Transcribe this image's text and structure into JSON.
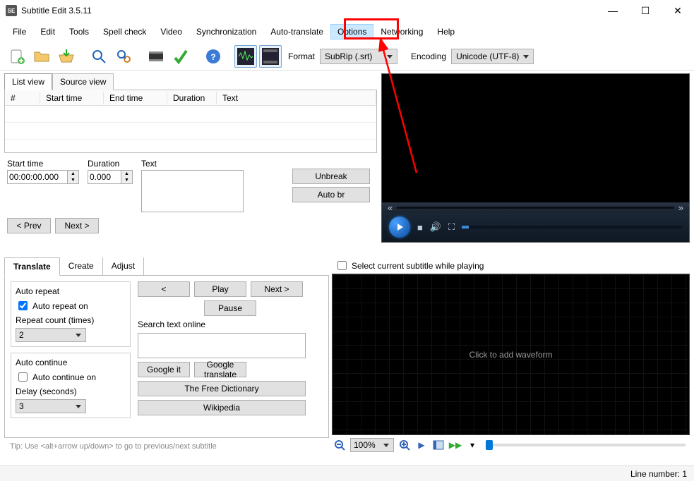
{
  "title": "Subtitle Edit 3.5.11",
  "menu": {
    "file": "File",
    "edit": "Edit",
    "tools": "Tools",
    "spell": "Spell check",
    "video": "Video",
    "sync": "Synchronization",
    "auto": "Auto-translate",
    "options": "Options",
    "net": "Networking",
    "help": "Help"
  },
  "format": {
    "label": "Format",
    "value": "SubRip (.srt)"
  },
  "encoding": {
    "label": "Encoding",
    "value": "Unicode (UTF-8)"
  },
  "tabs": {
    "list": "List view",
    "source": "Source view"
  },
  "grid": {
    "num": "#",
    "start": "Start time",
    "end": "End time",
    "dur": "Duration",
    "text": "Text"
  },
  "edit": {
    "start_label": "Start time",
    "start_val": "00:00:00.000",
    "dur_label": "Duration",
    "dur_val": "0.000",
    "text_label": "Text",
    "unbreak": "Unbreak",
    "autobr": "Auto br",
    "prev": "< Prev",
    "next": "Next >"
  },
  "bottabs": {
    "translate": "Translate",
    "create": "Create",
    "adjust": "Adjust"
  },
  "auto_repeat": {
    "title": "Auto repeat",
    "on": "Auto repeat on",
    "count_label": "Repeat count (times)",
    "count_val": "2"
  },
  "auto_cont": {
    "title": "Auto continue",
    "on": "Auto continue on",
    "delay_label": "Delay (seconds)",
    "delay_val": "3"
  },
  "pb": {
    "prev": "<",
    "play": "Play",
    "next": "Next >",
    "pause": "Pause"
  },
  "search": {
    "label": "Search text online",
    "google": "Google it",
    "gtrans": "Google translate",
    "tfd": "The Free Dictionary",
    "wiki": "Wikipedia"
  },
  "tip": "Tip: Use <alt+arrow up/down> to go to previous/next subtitle",
  "select_while": "Select current subtitle while playing",
  "waveform": "Click to add waveform",
  "zoom": "100%",
  "status": "Line number: 1"
}
